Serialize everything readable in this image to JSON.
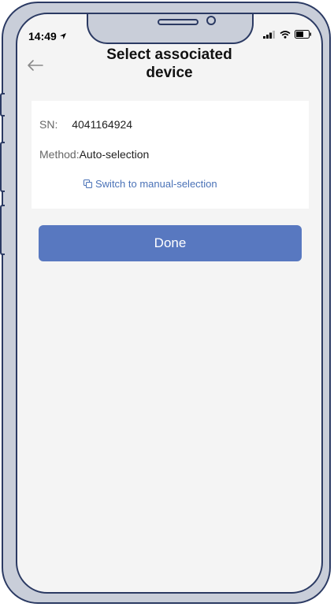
{
  "status_bar": {
    "time": "14:49"
  },
  "header": {
    "title_line1": "Select associated",
    "title_line2": "device"
  },
  "card": {
    "sn_label": "SN:",
    "sn_value": "4041164924",
    "method_label": "Method:",
    "method_value": "Auto-selection",
    "switch_link": "Switch to manual-selection"
  },
  "done_button": "Done",
  "icons": [
    "location-arrow-icon",
    "signal-icon",
    "wifi-icon",
    "battery-icon",
    "back-arrow-icon",
    "switch-icon"
  ],
  "colors": {
    "accent": "#5878c0",
    "link": "#4a72b7",
    "background": "#f4f4f4"
  }
}
